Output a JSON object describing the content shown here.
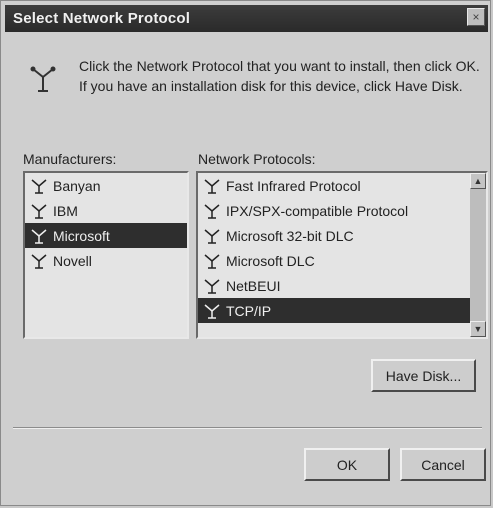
{
  "window": {
    "title": "Select Network Protocol",
    "close_label": "×"
  },
  "instruction": "Click the Network Protocol that you want to install, then click OK. If you have an installation disk for this device, click Have Disk.",
  "manufacturers": {
    "label": "Manufacturers:",
    "items": [
      {
        "label": "Banyan"
      },
      {
        "label": "IBM"
      },
      {
        "label": "Microsoft"
      },
      {
        "label": "Novell"
      }
    ],
    "selected": "Microsoft"
  },
  "protocols": {
    "label": "Network Protocols:",
    "items": [
      {
        "label": "Fast Infrared Protocol"
      },
      {
        "label": "IPX/SPX-compatible Protocol"
      },
      {
        "label": "Microsoft 32-bit DLC"
      },
      {
        "label": "Microsoft DLC"
      },
      {
        "label": "NetBEUI"
      },
      {
        "label": "TCP/IP"
      }
    ],
    "selected": "TCP/IP"
  },
  "buttons": {
    "have_disk": "Have Disk...",
    "ok": "OK",
    "cancel": "Cancel"
  },
  "icons": {
    "dialog_icon": "network-protocol-icon",
    "item_icon": "network-component-icon"
  }
}
